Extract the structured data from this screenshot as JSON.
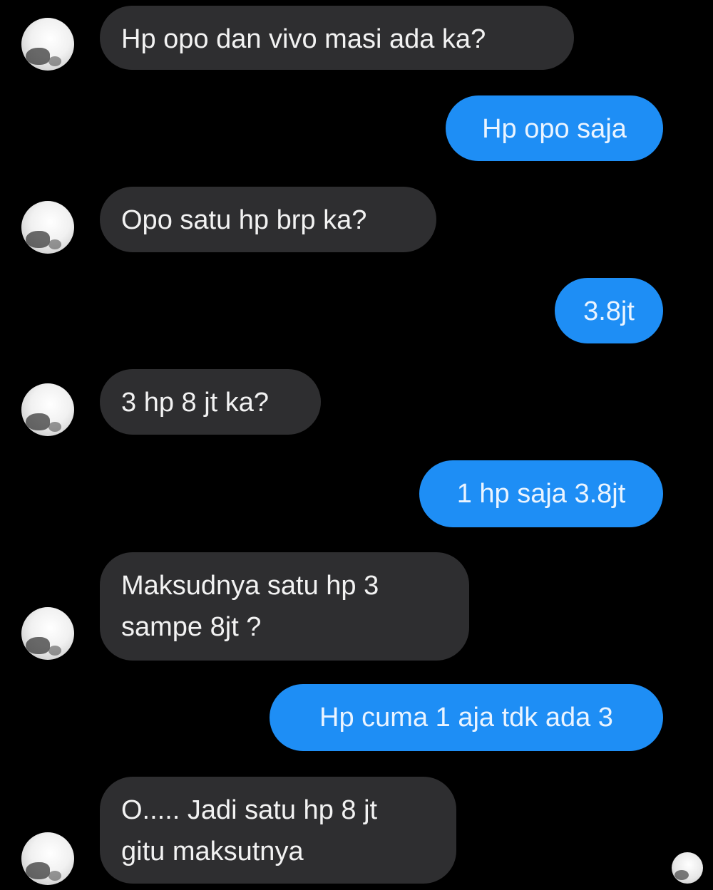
{
  "messages": [
    {
      "side": "incoming",
      "text": "Hp opo dan vivo masi ada ka?"
    },
    {
      "side": "outgoing",
      "text": "Hp opo saja"
    },
    {
      "side": "incoming",
      "text": "Opo satu hp brp ka?"
    },
    {
      "side": "outgoing",
      "text": "3.8jt"
    },
    {
      "side": "incoming",
      "text": "3 hp 8 jt ka?"
    },
    {
      "side": "outgoing",
      "text": "1 hp saja 3.8jt"
    },
    {
      "side": "incoming",
      "line1": "Maksudnya satu hp  3",
      "line2": "sampe 8jt ?"
    },
    {
      "side": "outgoing",
      "text": "Hp cuma 1 aja tdk ada 3"
    },
    {
      "side": "incoming",
      "line1": "O..... Jadi satu hp 8 jt",
      "line2": "gitu maksutnya"
    }
  ],
  "colors": {
    "background": "#000000",
    "incoming_bubble": "#2e2e30",
    "outgoing_bubble": "#1e8ef5",
    "text": "#f2f2f2"
  },
  "icons": {
    "sender_avatar": "contact-avatar-icon",
    "read_receipt": "seen-avatar-icon"
  }
}
